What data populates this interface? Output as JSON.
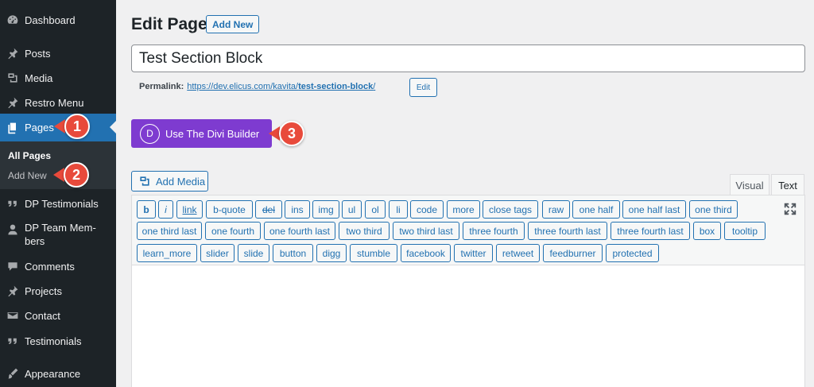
{
  "sidebar": {
    "items": [
      {
        "label": "Dashboard",
        "icon": "dashboard-icon"
      },
      {
        "label": "Posts",
        "icon": "pin-icon"
      },
      {
        "label": "Media",
        "icon": "media-icon"
      },
      {
        "label": "Restro Menu",
        "icon": "pin-icon"
      },
      {
        "label": "Pages",
        "icon": "pages-icon"
      },
      {
        "label": "DP Testimonials",
        "icon": "quote-icon"
      },
      {
        "label": "DP Team Mem-",
        "label2": "bers",
        "icon": "user-icon"
      },
      {
        "label": "Comments",
        "icon": "comments-icon"
      },
      {
        "label": "Projects",
        "icon": "pin-icon"
      },
      {
        "label": "Contact",
        "icon": "mail-icon"
      },
      {
        "label": "Testimonials",
        "icon": "quote-icon"
      },
      {
        "label": "Appearance",
        "icon": "brush-icon"
      }
    ],
    "submenu": [
      "All Pages",
      "Add New"
    ]
  },
  "callouts": [
    "1",
    "2",
    "3"
  ],
  "header": {
    "title": "Edit Page",
    "add_new": "Add New"
  },
  "post_title": "Test Section Block",
  "permalink": {
    "label": "Permalink:",
    "url_base": "https://dev.elicus.com/kavita/",
    "slug": "test-section-block",
    "trailing": "/",
    "edit": "Edit"
  },
  "divi": {
    "logo": "D",
    "label": "Use The Divi Builder"
  },
  "add_media": "Add Media",
  "tabs": {
    "visual": "Visual",
    "text": "Text"
  },
  "quicktags": [
    [
      "b",
      "i",
      "link",
      "b-quote",
      "del",
      "ins",
      "img",
      "ul",
      "ol",
      "li",
      "code",
      "more",
      "close tags",
      "raw",
      "one half",
      "one half last",
      "one third"
    ],
    [
      "one third last",
      "one fourth",
      "one fourth last",
      "two third",
      "two third last",
      "three fourth",
      "three fourth last",
      "three fourth last",
      "box",
      "tooltip"
    ],
    [
      "learn_more",
      "slider",
      "slide",
      "button",
      "digg",
      "stumble",
      "facebook",
      "twitter",
      "retweet",
      "feedburner",
      "protected"
    ]
  ],
  "colors": {
    "accent": "#2271b1",
    "sidebar": "#1d2327",
    "divi": "#7e3bd0",
    "callout": "#e84a3b"
  }
}
